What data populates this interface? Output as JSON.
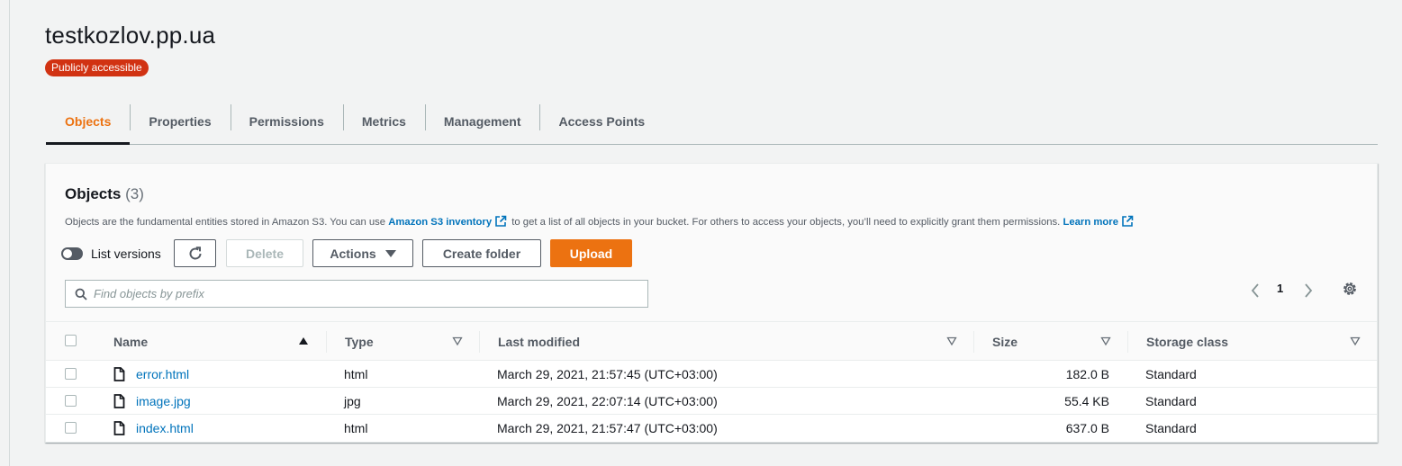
{
  "bucket": {
    "name": "testkozlov.pp.ua",
    "badge": "Publicly accessible"
  },
  "tabs": [
    {
      "label": "Objects",
      "active": true
    },
    {
      "label": "Properties",
      "active": false
    },
    {
      "label": "Permissions",
      "active": false
    },
    {
      "label": "Metrics",
      "active": false
    },
    {
      "label": "Management",
      "active": false
    },
    {
      "label": "Access Points",
      "active": false
    }
  ],
  "objects_panel": {
    "title": "Objects",
    "count": "(3)",
    "description_pre": "Objects are the fundamental entities stored in Amazon S3. You can use",
    "inventory_link": "Amazon S3 inventory",
    "description_mid": "to get a list of all objects in your bucket. For others to access your objects, you’ll need to explicitly grant them permissions.",
    "learn_more": "Learn more"
  },
  "toolbar": {
    "list_versions_label": "List versions",
    "list_versions_on": false,
    "delete_label": "Delete",
    "actions_label": "Actions",
    "create_folder_label": "Create folder",
    "upload_label": "Upload"
  },
  "search": {
    "placeholder": "Find objects by prefix",
    "value": ""
  },
  "pagination": {
    "current_page": "1"
  },
  "table": {
    "columns": {
      "name": "Name",
      "type": "Type",
      "last_modified": "Last modified",
      "size": "Size",
      "storage_class": "Storage class"
    },
    "rows": [
      {
        "name": "error.html",
        "type": "html",
        "last_modified": "March 29, 2021, 21:57:45 (UTC+03:00)",
        "size": "182.0 B",
        "storage_class": "Standard"
      },
      {
        "name": "image.jpg",
        "type": "jpg",
        "last_modified": "March 29, 2021, 22:07:14 (UTC+03:00)",
        "size": "55.4 KB",
        "storage_class": "Standard"
      },
      {
        "name": "index.html",
        "type": "html",
        "last_modified": "March 29, 2021, 21:57:47 (UTC+03:00)",
        "size": "637.0 B",
        "storage_class": "Standard"
      }
    ]
  },
  "colors": {
    "accent": "#ec7211",
    "link": "#0073bb",
    "badge": "#d13212",
    "background": "#f2f3f3"
  },
  "icons": [
    "external-link-icon",
    "refresh-icon",
    "caret-down-icon",
    "search-icon",
    "chevron-left-icon",
    "chevron-right-icon",
    "settings-gear-icon",
    "sort-ascending-icon",
    "sort-descending-icon",
    "file-icon"
  ]
}
